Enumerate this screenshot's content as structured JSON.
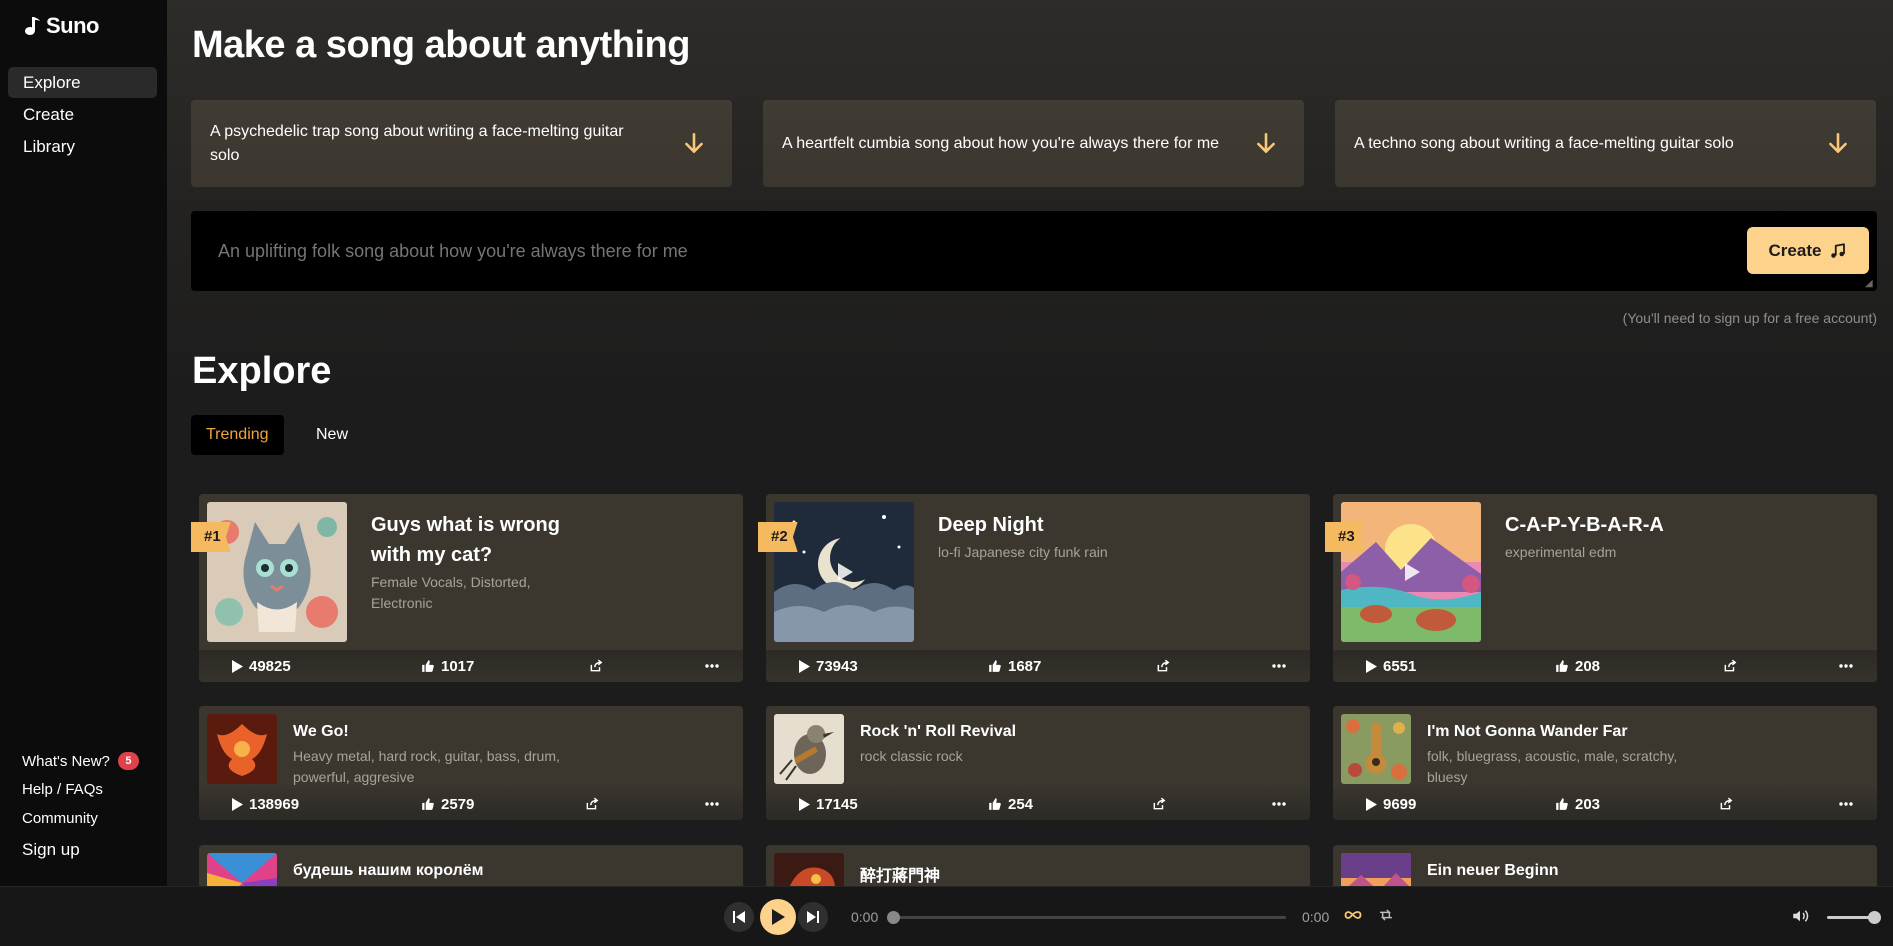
{
  "app": {
    "name": "Suno"
  },
  "sidebar": {
    "nav": [
      {
        "label": "Explore",
        "active": true
      },
      {
        "label": "Create"
      },
      {
        "label": "Library"
      }
    ],
    "footer": {
      "whats_new": "What's New?",
      "whats_new_badge": "5",
      "help": "Help / FAQs",
      "community": "Community",
      "sign_up": "Sign up"
    }
  },
  "hero": {
    "title": "Make a song about anything",
    "suggestions": [
      "A psychedelic trap song about writing a face-melting guitar solo",
      "A heartfelt cumbia song about how you're always there for me",
      "A techno song about writing a face-melting guitar solo"
    ],
    "prompt_placeholder": "An uplifting folk song about how you're always there for me",
    "create_label": "Create",
    "signup_note": "(You'll need to sign up for a free account)"
  },
  "explore": {
    "title": "Explore",
    "tabs": [
      {
        "label": "Trending",
        "active": true
      },
      {
        "label": "New"
      }
    ],
    "songs": [
      {
        "rank": "#1",
        "title": "Guys what is wrong with my cat?",
        "tags": "Female Vocals, Distorted, Electronic",
        "plays": "49825",
        "likes": "1017"
      },
      {
        "rank": "#2",
        "title": "Deep Night",
        "tags": "lo-fi Japanese city funk rain",
        "plays": "73943",
        "likes": "1687"
      },
      {
        "rank": "#3",
        "title": "C-A-P-Y-B-A-R-A",
        "tags": "experimental edm",
        "plays": "6551",
        "likes": "208"
      },
      {
        "title": "We Go!",
        "tags": "Heavy metal, hard rock, guitar, bass, drum, powerful, aggresive",
        "plays": "138969",
        "likes": "2579"
      },
      {
        "title": "Rock 'n' Roll Revival",
        "tags": "rock classic rock",
        "plays": "17145",
        "likes": "254"
      },
      {
        "title": "I'm Not Gonna Wander Far",
        "tags": "folk, bluegrass, acoustic, male, scratchy, bluesy",
        "plays": "9699",
        "likes": "203"
      },
      {
        "title": "будешь нашим королём"
      },
      {
        "title": "醉打蔣門神"
      },
      {
        "title": "Ein neuer Beginn"
      }
    ]
  },
  "player": {
    "current_time": "0:00",
    "duration": "0:00",
    "progress": 0,
    "volume": 1.0
  },
  "colors": {
    "accent": "#fdd28b",
    "rank_badge": "#f5b95f",
    "trending_text": "#f0a53c",
    "card_bg": "#3b372f",
    "sidebar_bg": "#0c0c0c"
  },
  "icons": [
    "suno-logo-icon",
    "arrow-down-icon",
    "music-note-icon",
    "play-icon",
    "thumbs-up-icon",
    "share-icon",
    "more-icon",
    "skip-previous-icon",
    "skip-next-icon",
    "loop-icon",
    "shuffle-icon",
    "volume-icon"
  ]
}
